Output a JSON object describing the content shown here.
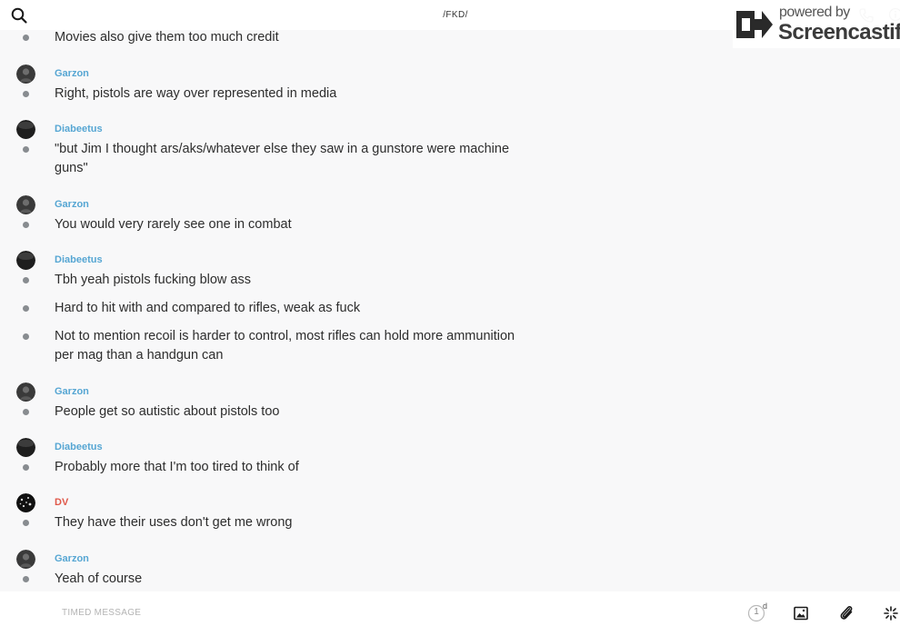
{
  "header": {
    "channel_title": "/FKD/"
  },
  "watermark": {
    "line1": "powered by",
    "line2": "Screencastify"
  },
  "messages": [
    {
      "sender": "",
      "sender_class": "",
      "avatar": "",
      "lines": [
        "Movies also give them too much credit"
      ]
    },
    {
      "sender": "Garzon",
      "sender_class": "",
      "avatar": "garzon",
      "lines": [
        "Right, pistols are way over represented in media"
      ]
    },
    {
      "sender": "Diabeetus",
      "sender_class": "",
      "avatar": "diabeetus",
      "lines": [
        "\"but Jim I thought ars/aks/whatever else they saw in a gunstore were machine guns\""
      ]
    },
    {
      "sender": "Garzon",
      "sender_class": "",
      "avatar": "garzon",
      "lines": [
        "You would very rarely see one in combat"
      ]
    },
    {
      "sender": "Diabeetus",
      "sender_class": "",
      "avatar": "diabeetus",
      "lines": [
        "Tbh yeah pistols fucking blow ass",
        "Hard to hit with and compared to rifles, weak as fuck",
        "Not to mention recoil is harder to control, most rifles can hold more ammunition per mag than a handgun can"
      ]
    },
    {
      "sender": "Garzon",
      "sender_class": "",
      "avatar": "garzon",
      "lines": [
        "People get so autistic about pistols too"
      ]
    },
    {
      "sender": "Diabeetus",
      "sender_class": "",
      "avatar": "diabeetus",
      "lines": [
        "Probably more that I'm too tired to think of"
      ]
    },
    {
      "sender": "DV",
      "sender_class": "dv",
      "avatar": "dv",
      "lines": [
        "They have their uses don't get me wrong"
      ]
    },
    {
      "sender": "Garzon",
      "sender_class": "",
      "avatar": "garzon",
      "lines": [
        "Yeah of course"
      ]
    }
  ],
  "composer": {
    "placeholder": "TIMED MESSAGE",
    "timer_count": "1",
    "timer_unit": "d"
  },
  "icons": {
    "search": "search-icon",
    "phone": "phone-icon",
    "info": "info-icon",
    "timer": "timer-icon",
    "image": "image-icon",
    "attach": "paperclip-icon",
    "spark": "sparkle-icon"
  },
  "colors": {
    "sender_name": "#56a6d3",
    "sender_name_dv": "#e0584a",
    "bullet": "#888c90"
  }
}
